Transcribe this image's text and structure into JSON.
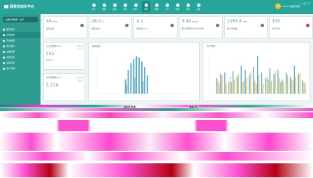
{
  "app": {
    "title": "园林自动化平台"
  },
  "nav": {
    "items": [
      "监控",
      "数据",
      "设备",
      "预警",
      "统计",
      "曲线",
      "视频",
      "日志",
      "设置",
      "帮助",
      "系统"
    ]
  },
  "user": {
    "text": "admin 超级管理员"
  },
  "sidebar": {
    "header": "土壤检测数据 · 总览",
    "items": [
      "首页总览",
      "实时监测",
      "历史数据",
      "统计报表",
      "设备管理",
      "告警记录",
      "系统设置",
      "用户管理"
    ]
  },
  "stats": [
    {
      "value": "46",
      "unit": "%RH",
      "label": "湿度监测"
    },
    {
      "value": "28.0",
      "unit": "℃",
      "label": "温度监测"
    },
    {
      "value": "4.1",
      "unit": "",
      "label": "酸碱度(pH)"
    },
    {
      "value": "3.40",
      "unit": "kW/㎡",
      "label": "累计灌溉量(历史平均值)"
    },
    {
      "value": "1563.4",
      "unit": "kWh",
      "label": "累计用电量"
    },
    {
      "value": "100",
      "unit": "",
      "label": "运行状态"
    }
  ],
  "mini_cards": [
    {
      "title": "今日灌溉量",
      "unit": "(m³)",
      "value": "252",
      "sub": "较昨日 ↑"
    },
    {
      "title": "本月灌溉量",
      "unit": "(m³)",
      "value": "5,719",
      "sub": ""
    }
  ],
  "charts": [
    {
      "title": "趋势曲线"
    },
    {
      "title": "历史数据"
    }
  ],
  "bottom": {
    "labels": [
      "设备运行状态",
      "数据说明"
    ]
  },
  "colors": {
    "teal": "#27a59a",
    "bar_blue": "#5aaec7",
    "bar_yellow": "#e7c45a",
    "bar_gray": "#a7b4b6"
  }
}
